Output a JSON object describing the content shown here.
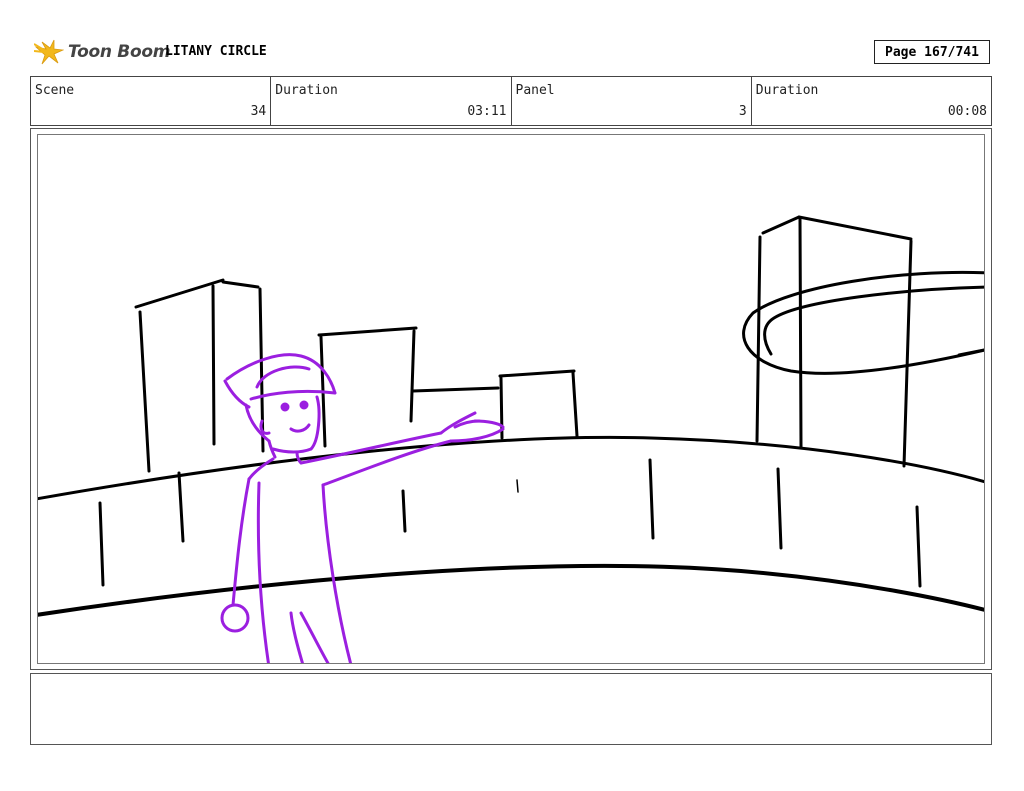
{
  "header": {
    "logo_text": "Toon Boom",
    "project_title": "LITANY CIRCLE",
    "page_label": "Page 167/741"
  },
  "info": {
    "scene_label": "Scene",
    "scene_value": "34",
    "scene_duration_label": "Duration",
    "scene_duration_value": "03:11",
    "panel_label": "Panel",
    "panel_value": "3",
    "panel_duration_label": "Duration",
    "panel_duration_value": "00:08"
  },
  "colors": {
    "background_sketch": "#000000",
    "character_sketch": "#9b1fe0",
    "logo_star": "#f2b81c"
  },
  "icons": {
    "logo": "toon-boom-star-icon"
  },
  "notes": {
    "text": ""
  }
}
